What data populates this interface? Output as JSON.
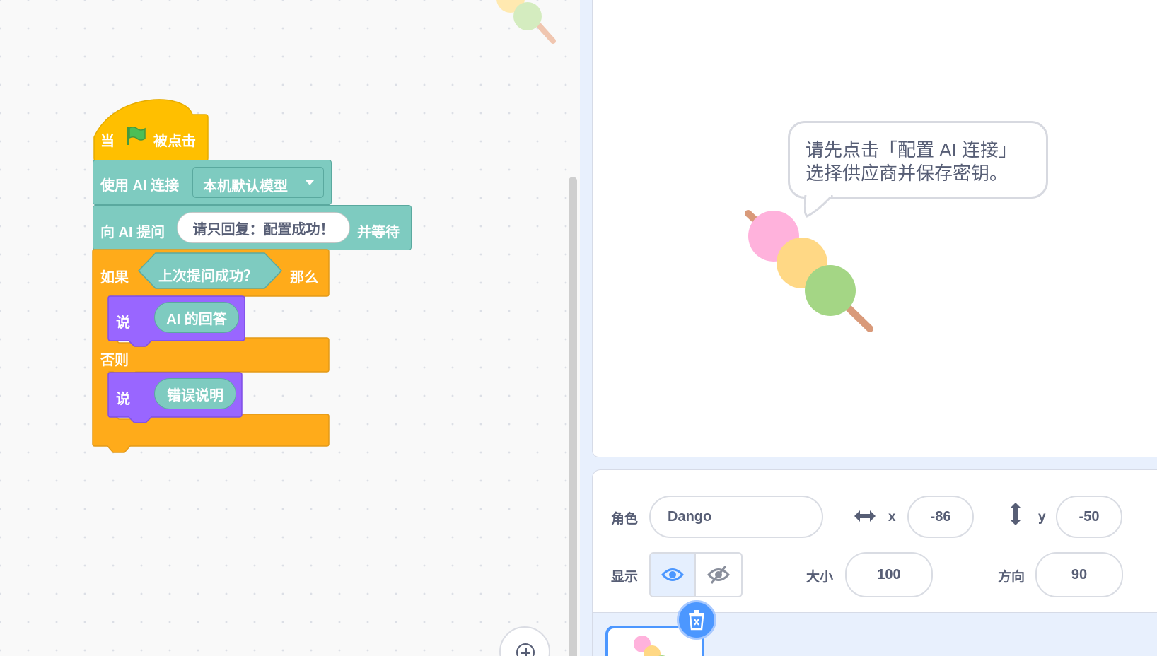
{
  "blocks": {
    "hat": {
      "when": "当",
      "clicked": "被点击"
    },
    "connect": {
      "label": "使用 AI 连接",
      "model": "本机默认模型"
    },
    "ask": {
      "label": "向 AI 提问",
      "prompt": "请只回复：配置成功！",
      "wait": "并等待"
    },
    "if": {
      "label": "如果",
      "condition": "上次提问成功？",
      "then": "那么"
    },
    "say1": {
      "label": "说",
      "value": "AI 的回答"
    },
    "else": {
      "label": "否则"
    },
    "say2": {
      "label": "说",
      "value": "错误说明"
    }
  },
  "stage": {
    "bubble_line1": "请先点击「配置 AI 连接」",
    "bubble_line2": "选择供应商并保存密钥。"
  },
  "sprite": {
    "name_label": "角色",
    "name": "Dango",
    "x_label": "x",
    "x": "-86",
    "y_label": "y",
    "y": "-50",
    "show_label": "显示",
    "size_label": "大小",
    "size": "100",
    "direction_label": "方向",
    "direction": "90"
  },
  "colors": {
    "events": "#ffbf00",
    "control": "#ffab1a",
    "looks": "#9966ff",
    "ai": "#7ecbc0",
    "accent": "#4c97ff"
  }
}
